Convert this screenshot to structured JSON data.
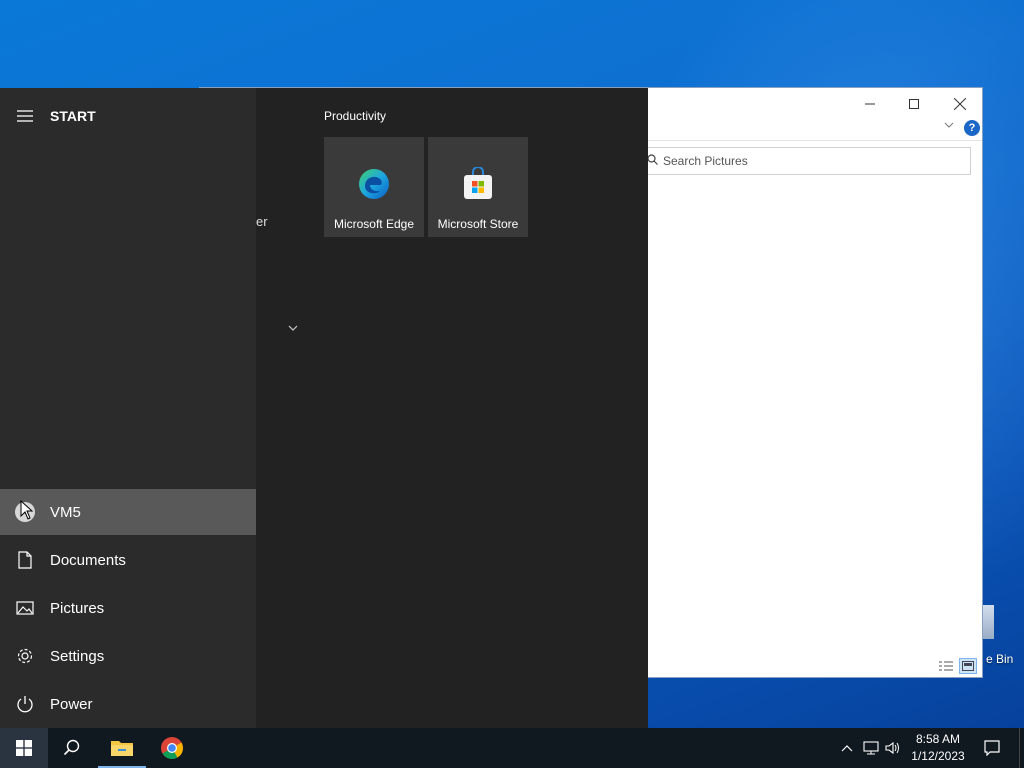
{
  "start_menu": {
    "title": "START",
    "group_title": "Productivity",
    "applist_fragment": "er",
    "left_items": [
      {
        "label": "VM5",
        "icon": "user-avatar-icon"
      },
      {
        "label": "Documents",
        "icon": "document-icon"
      },
      {
        "label": "Pictures",
        "icon": "pictures-icon"
      },
      {
        "label": "Settings",
        "icon": "gear-icon"
      },
      {
        "label": "Power",
        "icon": "power-icon"
      }
    ],
    "tiles": [
      {
        "label": "Microsoft Edge",
        "icon": "edge-icon"
      },
      {
        "label": "Microsoft Store",
        "icon": "store-icon"
      }
    ]
  },
  "explorer": {
    "search_placeholder": "Search Pictures",
    "help_label": "?"
  },
  "desktop": {
    "recycle_bin_label": "e Bin"
  },
  "taskbar": {
    "time": "8:58 AM",
    "date": "1/12/2023"
  },
  "colors": {
    "start_bg": "#222222",
    "start_left_bg": "#2b2b2b",
    "hover_bg": "#595959",
    "tile_bg": "#3a3a3a",
    "taskbar_bg": "#101820",
    "accent": "#1a66c9"
  }
}
